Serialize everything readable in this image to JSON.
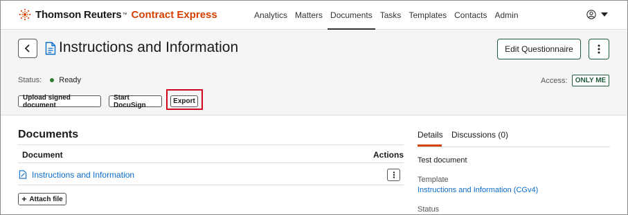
{
  "topbar": {
    "brand": "Thomson Reuters",
    "brand_tm": "™",
    "product": "Contract Express",
    "nav": [
      "Analytics",
      "Matters",
      "Documents",
      "Tasks",
      "Templates",
      "Contacts",
      "Admin"
    ],
    "active_nav": "Documents"
  },
  "header": {
    "title": "Instructions and Information",
    "edit_button": "Edit Questionnaire",
    "status_label": "Status:",
    "status_value": "Ready",
    "access_label": "Access:",
    "access_value": "ONLY ME",
    "actions": {
      "upload": "Upload signed document",
      "docusign": "Start DocuSign",
      "export": "Export"
    }
  },
  "documents": {
    "title": "Documents",
    "columns": [
      "Document",
      "Actions"
    ],
    "rows": [
      {
        "name": "Instructions and Information"
      }
    ],
    "attach_label": "Attach file"
  },
  "details": {
    "tabs": [
      "Details",
      "Discussions (0)"
    ],
    "active_tab": "Details",
    "description": "Test document",
    "template_label": "Template",
    "template_value": "Instructions and Information (CGv4)",
    "status_label": "Status"
  },
  "colors": {
    "accent_orange": "#d64000",
    "link_blue": "#0b6cc7",
    "ready_green": "#2e7d32",
    "highlight_red": "#d0021b"
  }
}
